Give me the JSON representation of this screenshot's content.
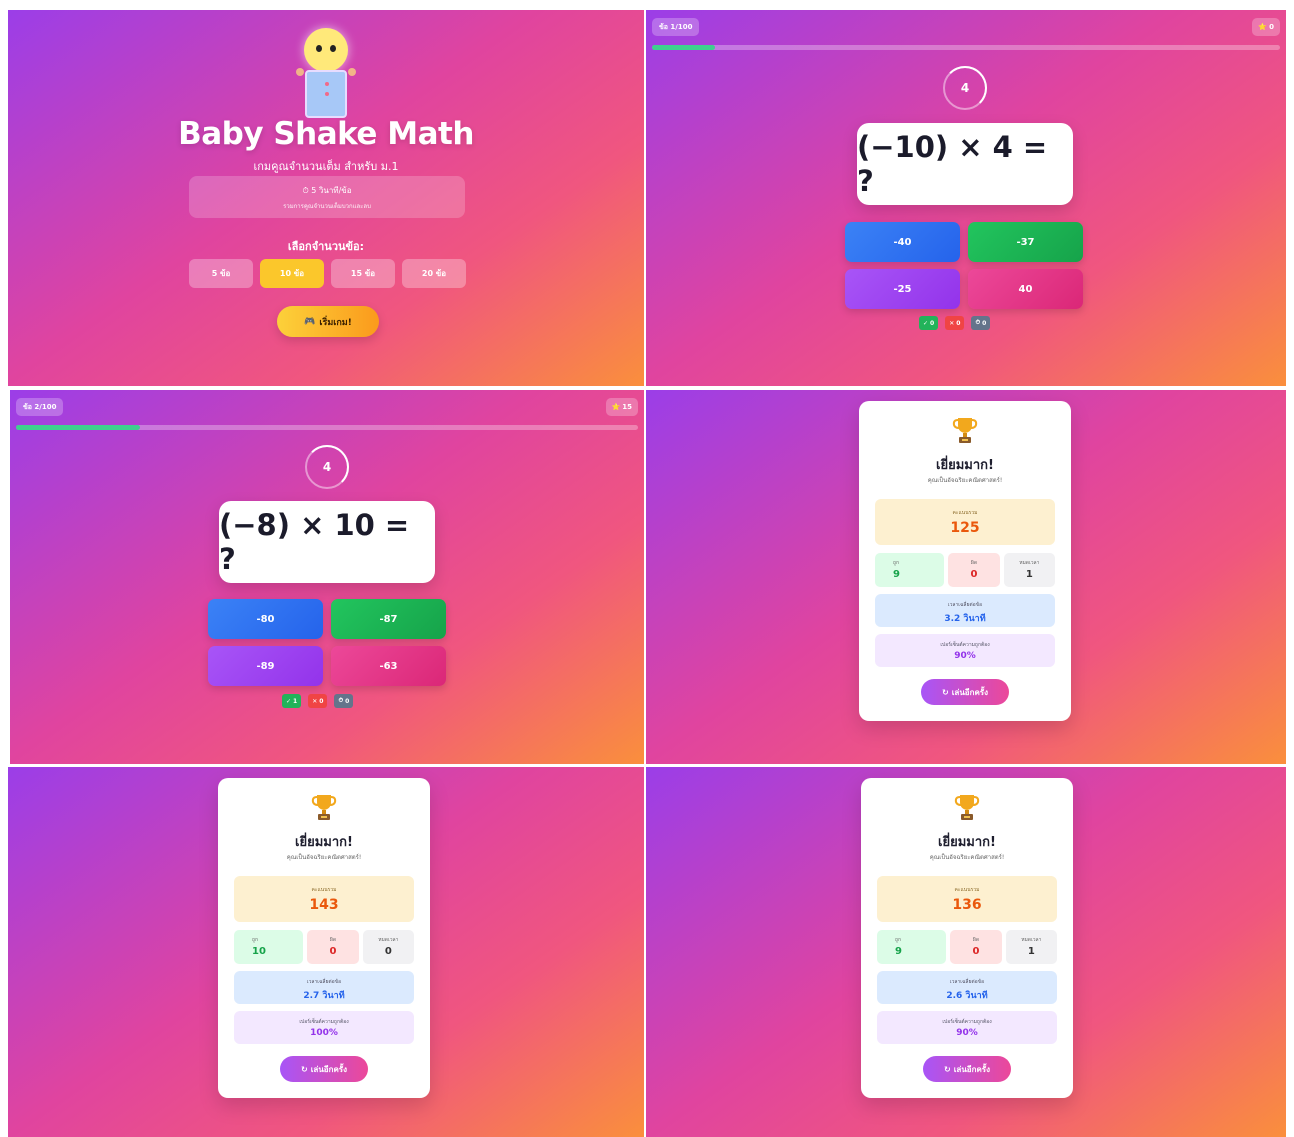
{
  "start": {
    "title": "Baby Shake Math",
    "subtitle": "เกมคูณจำนวนเต็ม สำหรับ ม.1",
    "info_time": "⏱ 5 วินาที/ข้อ",
    "info_desc": "รวมการคูณจำนวนเต็มบวกและลบ",
    "choose_label": "เลือกจำนวนข้อ:",
    "options": [
      "5 ข้อ",
      "10 ข้อ",
      "15 ข้อ",
      "20 ข้อ"
    ],
    "selected": "10 ข้อ",
    "start_button": "เริ่มเกม!"
  },
  "quiz1": {
    "question_label": "ข้อ 1/100",
    "score": "0",
    "progress": 0.1,
    "timer": "4",
    "question": "(−10) × 4 = ?",
    "answers": [
      "-40",
      "-37",
      "-25",
      "40"
    ],
    "correct": "0",
    "wrong": "0",
    "timeout": "0"
  },
  "quiz2": {
    "question_label": "ข้อ 2/100",
    "score": "15",
    "progress": 0.2,
    "timer": "4",
    "question": "(−8) × 10 = ?",
    "answers": [
      "-80",
      "-87",
      "-89",
      "-63"
    ],
    "correct": "1",
    "wrong": "0",
    "timeout": "0"
  },
  "results": [
    {
      "title": "เยี่ยมมาก!",
      "subtitle": "คุณเป็นอัจฉริยะคณิตศาสตร์!",
      "total_label": "คะแนนรวม",
      "total": "125",
      "correct_label": "ถูก",
      "correct": "9",
      "wrong_label": "ผิด",
      "wrong": "0",
      "timeout_label": "หมดเวลา",
      "timeout": "1",
      "avg_label": "เวลาเฉลี่ยต่อข้อ",
      "avg": "3.2 วินาที",
      "acc_label": "เปอร์เซ็นต์ความถูกต้อง",
      "acc": "90%",
      "button": "เล่นอีกครั้ง"
    },
    {
      "title": "เยี่ยมมาก!",
      "subtitle": "คุณเป็นอัจฉริยะคณิตศาสตร์!",
      "total_label": "คะแนนรวม",
      "total": "143",
      "correct_label": "ถูก",
      "correct": "10",
      "wrong_label": "ผิด",
      "wrong": "0",
      "timeout_label": "หมดเวลา",
      "timeout": "0",
      "avg_label": "เวลาเฉลี่ยต่อข้อ",
      "avg": "2.7 วินาที",
      "acc_label": "เปอร์เซ็นต์ความถูกต้อง",
      "acc": "100%",
      "button": "เล่นอีกครั้ง"
    },
    {
      "title": "เยี่ยมมาก!",
      "subtitle": "คุณเป็นอัจฉริยะคณิตศาสตร์!",
      "total_label": "คะแนนรวม",
      "total": "136",
      "correct_label": "ถูก",
      "correct": "9",
      "wrong_label": "ผิด",
      "wrong": "0",
      "timeout_label": "หมดเวลา",
      "timeout": "1",
      "avg_label": "เวลาเฉลี่ยต่อข้อ",
      "avg": "2.6 วินาที",
      "acc_label": "เปอร์เซ็นต์ความถูกต้อง",
      "acc": "90%",
      "button": "เล่นอีกครั้ง"
    }
  ],
  "icons": {
    "check": "✓",
    "cross": "✕",
    "timeout": "⏱",
    "score": "⭐",
    "controller": "🎮",
    "replay": "↻"
  }
}
